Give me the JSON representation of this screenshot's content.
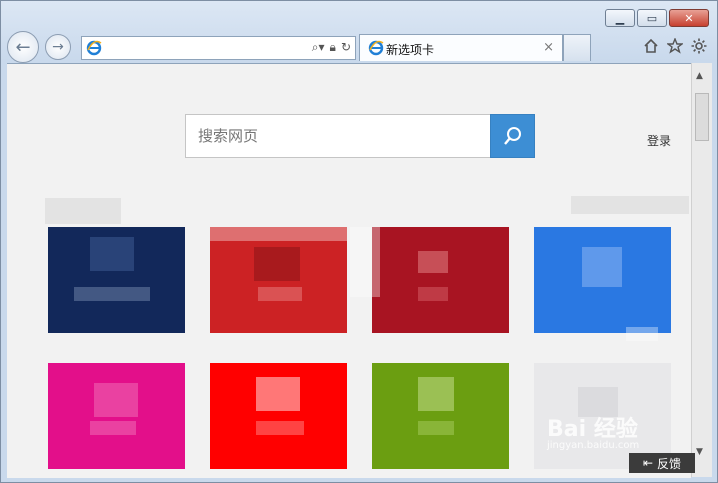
{
  "browser": {
    "tab_title": "新选项卡",
    "tab_close": "×",
    "address_value": ""
  },
  "page": {
    "search_placeholder": "搜索网页",
    "login_label": "登录"
  },
  "tiles": [
    {
      "color": "#12285a"
    },
    {
      "color": "#cc2224"
    },
    {
      "color": "#a81422"
    },
    {
      "color": "#2a78e2"
    },
    {
      "color": "#e30f8a"
    },
    {
      "color": "#ff0000"
    },
    {
      "color": "#6b9e11"
    },
    {
      "color": "#e8e8ea"
    }
  ],
  "overlay": {
    "feedback_label": "反馈",
    "watermark_main": "Bai 经验",
    "watermark_sub": "jingyan.baidu.com"
  }
}
